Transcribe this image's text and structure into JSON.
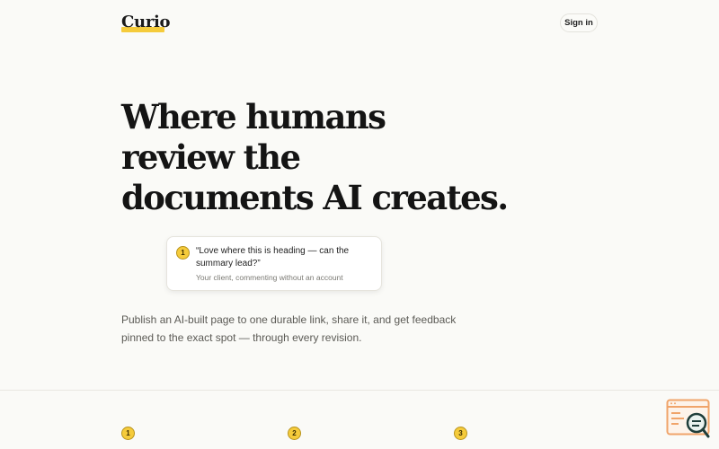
{
  "header": {
    "logo": "Curio",
    "sign_in": "Sign in"
  },
  "hero": {
    "line1": "Where humans",
    "line2_highlight": "review",
    "line2_rest": " the",
    "line3": "documents AI creates."
  },
  "comment": {
    "pin": "1",
    "quote": "“Love where this is heading — can the summary lead?”",
    "author": "Your client, commenting without an account"
  },
  "blurb": "Publish an AI-built page to one durable link, share it, and get feedback pinned to the exact spot — through every revision.",
  "steps": [
    "1",
    "2",
    "3"
  ],
  "colors": {
    "accent": "#f5cb3b",
    "background": "#fafaf7",
    "widget": "#f0a46a"
  },
  "icons": {
    "widget": "review-search-icon"
  }
}
